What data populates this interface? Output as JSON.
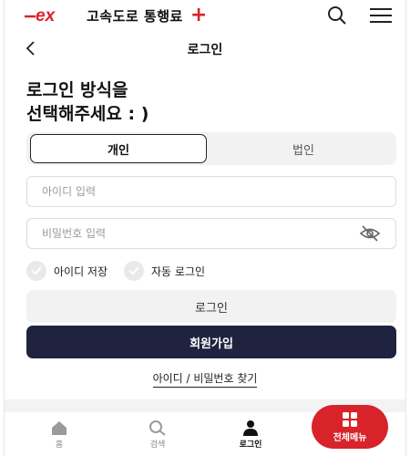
{
  "app": {
    "brand": "ex",
    "name": "고속도로 통행료",
    "plus": "+",
    "brand_color": "#d8232a"
  },
  "header": {
    "title": "로그인"
  },
  "heading": {
    "line1": "로그인 방식을",
    "line2": "선택해주세요 : )"
  },
  "tabs": [
    {
      "label": "개인",
      "selected": true
    },
    {
      "label": "법인",
      "selected": false
    }
  ],
  "form": {
    "id_placeholder": "아이디 입력",
    "password_placeholder": "비밀번호 입력",
    "save_id_label": "아이디 저장",
    "auto_login_label": "자동 로그인",
    "login_button": "로그인",
    "join_button": "회원가입",
    "find_link": "아이디 / 비밀번호 찾기"
  },
  "bottom_nav": [
    {
      "label": "홈",
      "icon": "home-icon"
    },
    {
      "label": "검색",
      "icon": "search-icon"
    },
    {
      "label": "로그인",
      "icon": "person-icon",
      "active": true
    }
  ],
  "menu_button": {
    "label": "전체메뉴",
    "icon": "grid-icon"
  },
  "colors": {
    "primary_dark": "#1f2340",
    "accent_red": "#d8232a"
  }
}
